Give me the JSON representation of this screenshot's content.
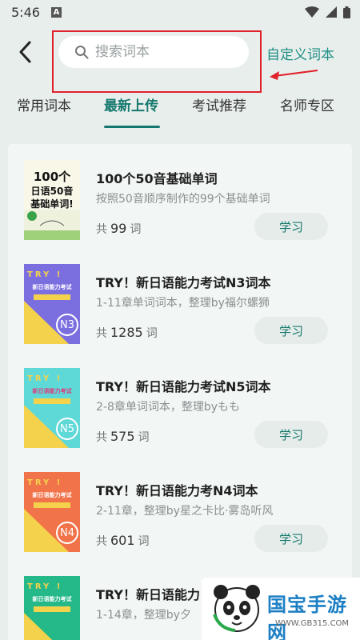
{
  "status": {
    "time": "5:46",
    "notif_letter": "A"
  },
  "header": {
    "search_placeholder": "搜索词本",
    "custom_link": "自定义词本"
  },
  "tabs": [
    {
      "label": "常用词本"
    },
    {
      "label": "最新上传"
    },
    {
      "label": "考试推荐"
    },
    {
      "label": "名师专区"
    }
  ],
  "colors": {
    "accent": "#15786e",
    "annotation": "#e0202a"
  },
  "books": [
    {
      "title": "100个50音基础单词",
      "desc": "按照50音顺序制作的99个基础单词",
      "count_prefix": "共",
      "count": "99",
      "count_unit": "词",
      "button": "学习",
      "cover": {
        "line1": "100个",
        "line2": "日语50音",
        "line3": "基础单词!"
      }
    },
    {
      "title": "TRY！新日语能力考试N3词本",
      "desc": "1-11章单词词本，整理by福尔螺狮",
      "count_prefix": "共",
      "count": "1285",
      "count_unit": "词",
      "button": "学习",
      "cover": {
        "try": "TRY !",
        "sub": "新日语能力考试",
        "badge": "N3",
        "bg": "#7b6fe0",
        "accent": "#f5d24b"
      }
    },
    {
      "title": "TRY！新日语能力考试N5词本",
      "desc": "2-8章单词词本，整理byもも",
      "count_prefix": "共",
      "count": "575",
      "count_unit": "词",
      "button": "学习",
      "cover": {
        "try": "TRY !",
        "sub": "新日语能力考试",
        "badge": "N5",
        "bg": "#5fd8d8",
        "accent": "#f5d24b"
      }
    },
    {
      "title": "TRY！新日语能力考N4词本",
      "desc": "2-11章，整理by星之卡比·雾岛听风",
      "count_prefix": "共",
      "count": "601",
      "count_unit": "词",
      "button": "学习",
      "cover": {
        "try": "TRY !",
        "sub": "新日语能力考试",
        "badge": "N4",
        "bg": "#f0734a",
        "accent": "#f5d24b"
      }
    },
    {
      "title": "TRY！新日语能力",
      "desc": "1-14章，整理by夕",
      "count_prefix": "",
      "count": "",
      "count_unit": "",
      "button": "",
      "cover": {
        "try": "TRY !",
        "sub": "新日语能力考试",
        "badge": "",
        "bg": "#25b889",
        "accent": "#f5d24b"
      }
    }
  ],
  "watermark": {
    "text": "国宝手游网",
    "url": "WWW.GB315.COM"
  }
}
